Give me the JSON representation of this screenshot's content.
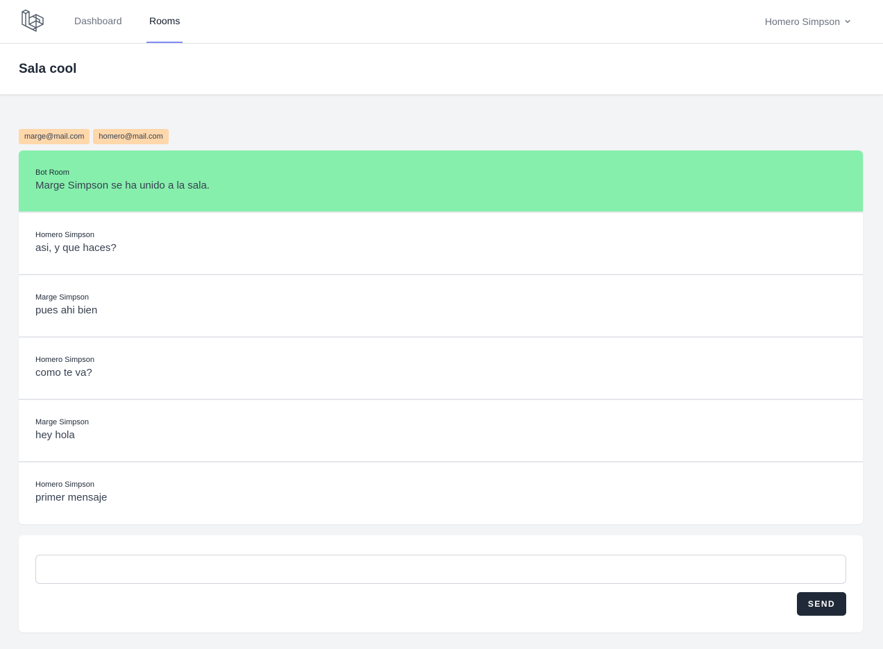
{
  "nav": {
    "logo_icon": "laravel-logo-icon",
    "links": [
      {
        "label": "Dashboard",
        "active": false
      },
      {
        "label": "Rooms",
        "active": true
      }
    ],
    "user": {
      "name": "Homero Simpson",
      "icon": "chevron-down-icon"
    }
  },
  "header": {
    "title": "Sala cool"
  },
  "participants": [
    "marge@mail.com",
    "homero@mail.com"
  ],
  "messages": [
    {
      "author": "Bot Room",
      "text": "Marge Simpson se ha unido a la sala.",
      "type": "bot"
    },
    {
      "author": "Homero Simpson",
      "text": "asi, y que haces?",
      "type": "user"
    },
    {
      "author": "Marge Simpson",
      "text": "pues ahi bien",
      "type": "user"
    },
    {
      "author": "Homero Simpson",
      "text": "como te va?",
      "type": "user"
    },
    {
      "author": "Marge Simpson",
      "text": "hey hola",
      "type": "user"
    },
    {
      "author": "Homero Simpson",
      "text": "primer mensaje",
      "type": "user"
    }
  ],
  "composer": {
    "input_value": "",
    "send_label": "SEND"
  },
  "colors": {
    "active_tab_underline": "#818cf8",
    "bot_message_bg": "#86efac",
    "participant_badge_bg": "#fed7aa",
    "send_button_bg": "#1f2937"
  }
}
